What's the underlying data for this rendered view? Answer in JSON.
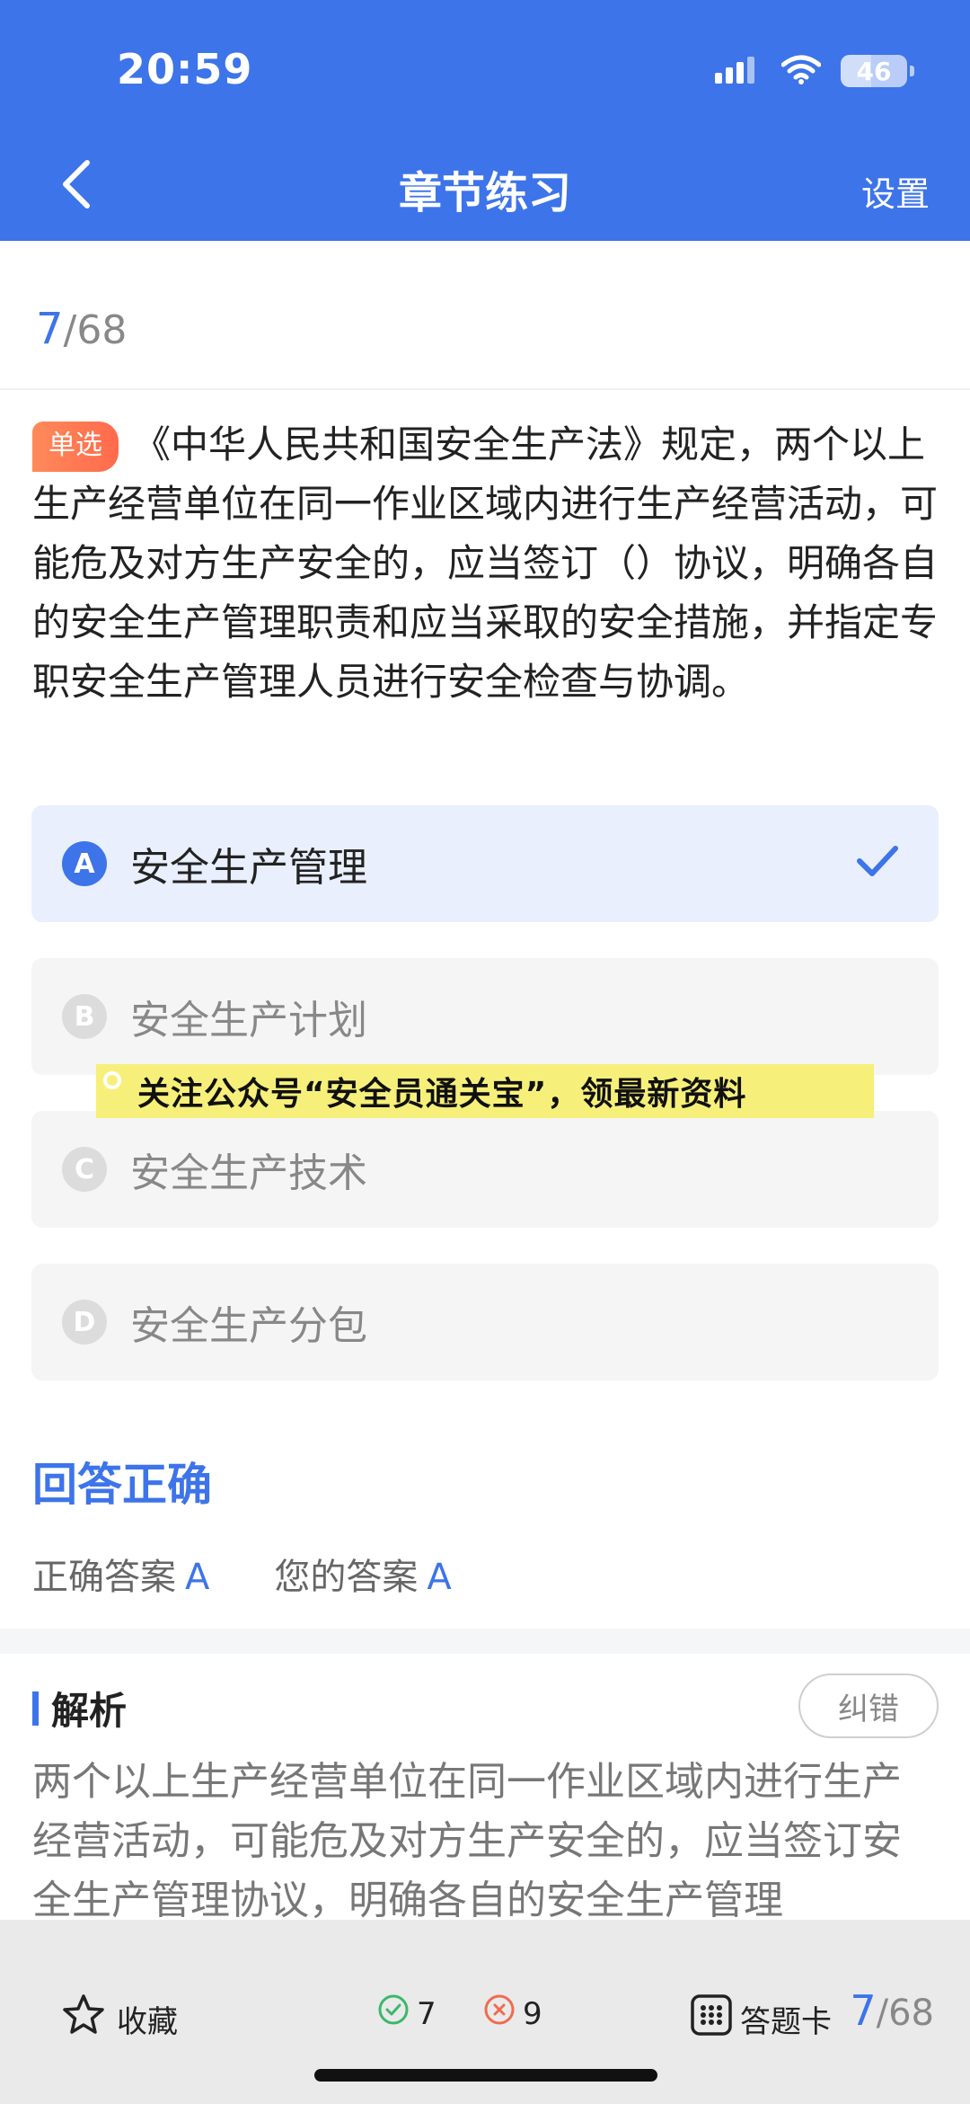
{
  "status": {
    "time": "20:59",
    "battery": "46",
    "battery_level": 0.46
  },
  "header": {
    "title": "章节练习",
    "settings_label": "设置"
  },
  "progress": {
    "current": "7",
    "total": "/68"
  },
  "question": {
    "type_tag": "单选",
    "text": "《中华人民共和国安全生产法》规定，两个以上生产经营单位在同一作业区域内进行生产经营活动，可能危及对方生产安全的，应当签订（）协议，明确各自的安全生产管理职责和应当采取的安全措施，并指定专职安全生产管理人员进行安全检查与协调。"
  },
  "options": [
    {
      "letter": "A",
      "text": "安全生产管理",
      "selected": true
    },
    {
      "letter": "B",
      "text": "安全生产计划",
      "selected": false
    },
    {
      "letter": "C",
      "text": "安全生产技术",
      "selected": false
    },
    {
      "letter": "D",
      "text": "安全生产分包",
      "selected": false
    }
  ],
  "banner": {
    "text": "关注公众号“安全员通关宝”，领最新资料"
  },
  "result": {
    "title": "回答正确",
    "correct_label": "正确答案",
    "correct_value": "A",
    "your_label": "您的答案",
    "your_value": "A"
  },
  "analysis": {
    "title": "解析",
    "report_label": "纠错",
    "text": "两个以上生产经营单位在同一作业区域内进行生产经营活动，可能危及对方生产安全的，应当签订安全生产管理协议，明确各自的安全生产管理"
  },
  "bottom_bar": {
    "favorite_label": "收藏",
    "correct_count": "7",
    "wrong_count": "9",
    "answer_card_label": "答题卡",
    "page_current": "7",
    "page_total": "/68"
  },
  "colors": {
    "accent": "#3d74ea",
    "tag": "#ff6a4c",
    "correct": "#3bb86a",
    "wrong": "#f26b4f",
    "banner": "#f6f07a"
  },
  "icons": [
    "back-icon",
    "signal-icon",
    "wifi-icon",
    "battery-icon",
    "check-icon",
    "star-icon",
    "check-circle-icon",
    "x-circle-icon",
    "grid-icon"
  ]
}
